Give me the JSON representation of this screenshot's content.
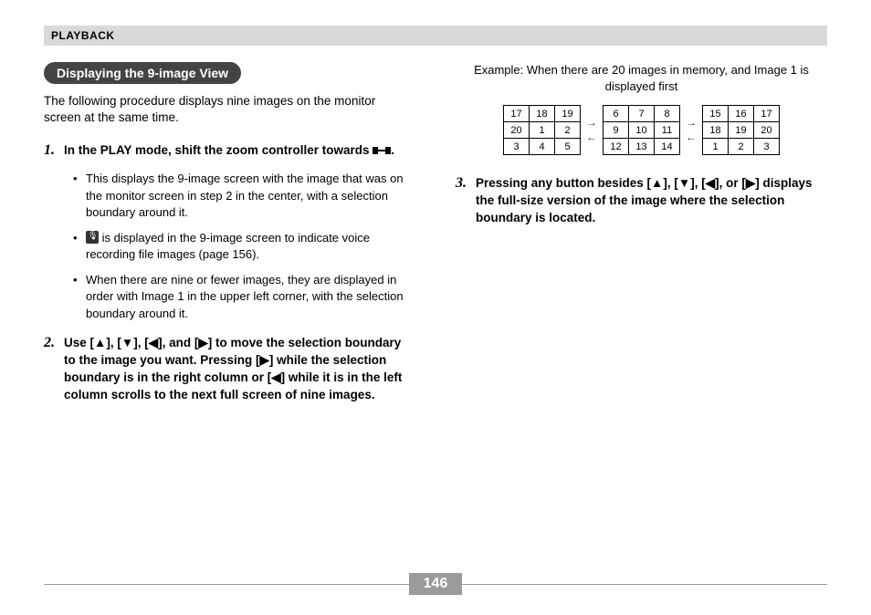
{
  "header": "PLAYBACK",
  "section_title": "Displaying the 9-image View",
  "intro": "The following procedure displays nine images on the monitor screen at the same time.",
  "steps": {
    "s1": {
      "num": "1.",
      "head_a": "In the PLAY mode, shift the zoom controller towards ",
      "head_b": ".",
      "b1": "This displays the 9-image screen with the image that was on the monitor screen in step 2 in the center, with a selection boundary around it.",
      "b2a": " is displayed in the 9-image screen to indicate voice recording file images (page 156).",
      "b3": "When there are nine or fewer images, they are displayed in order with Image 1 in the upper left corner, with the selection boundary around it."
    },
    "s2": {
      "num": "2.",
      "head": "Use [▲], [▼], [◀], and [▶] to move the selection boundary to the image you want. Pressing [▶] while the selection boundary is in the right column or [◀] while it is in the left column scrolls to the next full screen of nine images."
    },
    "s3": {
      "num": "3.",
      "head": "Pressing any button besides [▲], [▼], [◀], or [▶] displays the full-size version of the image where the selection boundary is located."
    }
  },
  "example_label": "Example: When there are 20 images in memory, and Image 1 is displayed first",
  "grids": [
    [
      [
        "17",
        "18",
        "19"
      ],
      [
        "20",
        "1",
        "2"
      ],
      [
        "3",
        "4",
        "5"
      ]
    ],
    [
      [
        "6",
        "7",
        "8"
      ],
      [
        "9",
        "10",
        "11"
      ],
      [
        "12",
        "13",
        "14"
      ]
    ],
    [
      [
        "15",
        "16",
        "17"
      ],
      [
        "18",
        "19",
        "20"
      ],
      [
        "1",
        "2",
        "3"
      ]
    ]
  ],
  "arrows": {
    "right": "→",
    "left": "←"
  },
  "page_number": "146"
}
